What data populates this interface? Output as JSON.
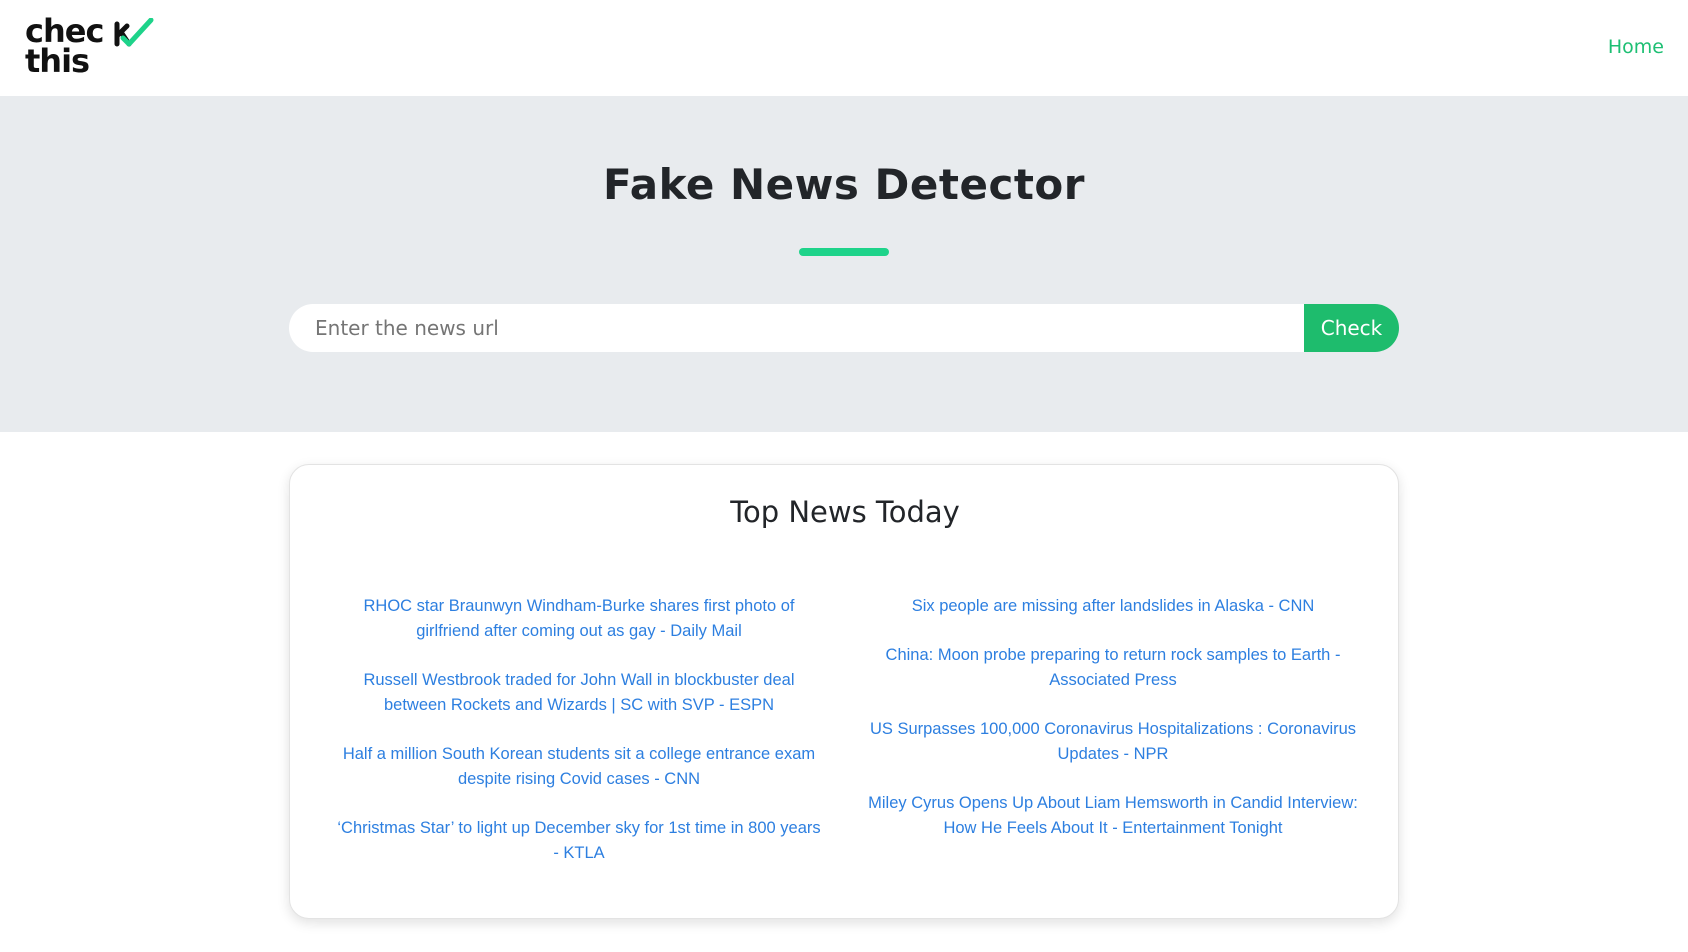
{
  "brand": {
    "logo_line1": "chec",
    "logo_line2": "this",
    "logo_accent": "#1ed38a"
  },
  "nav": {
    "home_label": "Home"
  },
  "hero": {
    "title": "Fake News Detector",
    "search_placeholder": "Enter the news url",
    "check_label": "Check"
  },
  "news": {
    "title": "Top News Today",
    "left": [
      "RHOC star Braunwyn Windham-Burke shares first photo of girlfriend after coming out as gay - Daily Mail",
      "Russell Westbrook traded for John Wall in blockbuster deal between Rockets and Wizards | SC with SVP - ESPN",
      "Half a million South Korean students sit a college entrance exam despite rising Covid cases - CNN",
      "‘Christmas Star’ to light up December sky for 1st time in 800 years - KTLA"
    ],
    "right": [
      "Six people are missing after landslides in Alaska - CNN",
      "China: Moon probe preparing to return rock samples to Earth - Associated Press",
      "US Surpasses 100,000 Coronavirus Hospitalizations : Coronavirus Updates - NPR",
      "Miley Cyrus Opens Up About Liam Hemsworth in Candid Interview: How He Feels About It - Entertainment Tonight"
    ]
  },
  "colors": {
    "accent_green": "#1ebc6d",
    "link_blue": "#2d7fe0",
    "hero_bg": "#e8ebee"
  }
}
